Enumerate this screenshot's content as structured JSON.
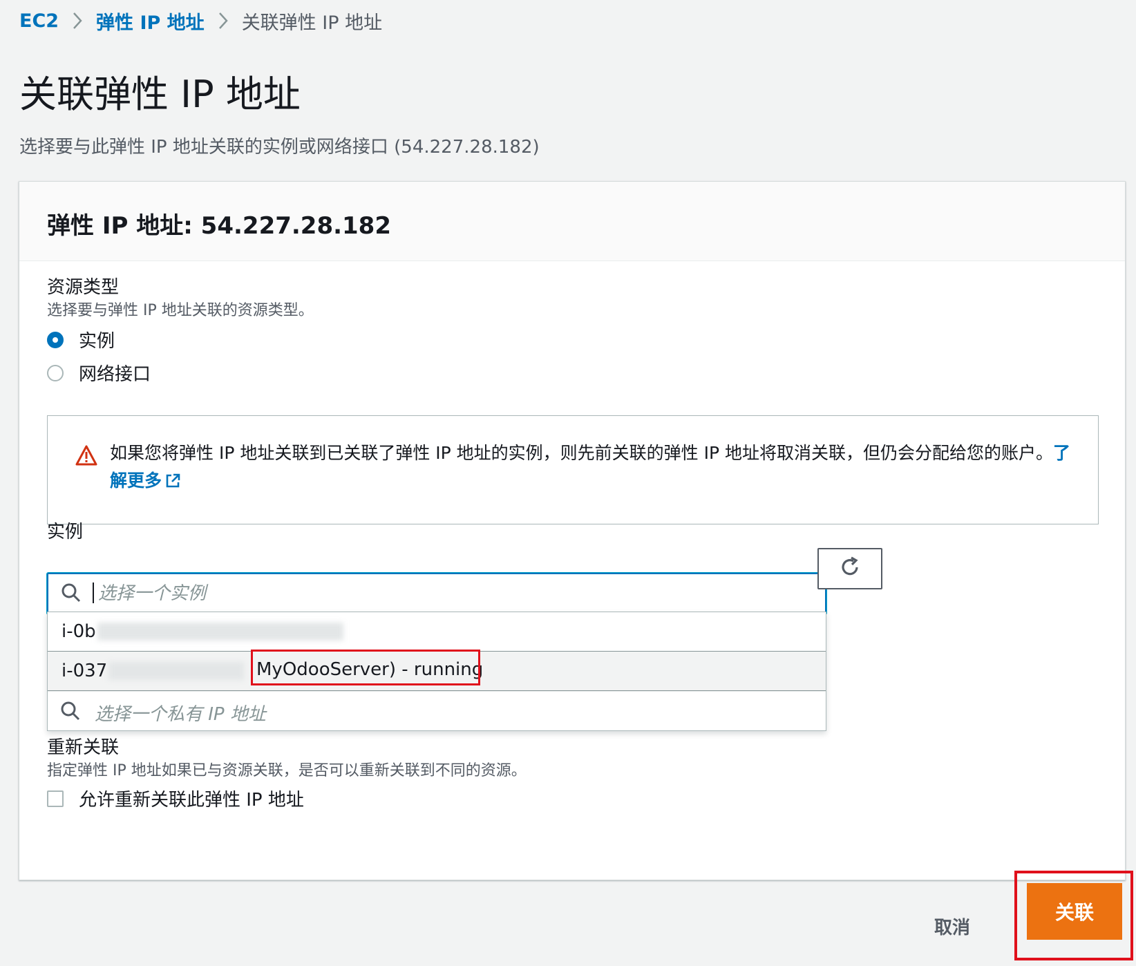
{
  "breadcrumb": {
    "root": "EC2",
    "parent": "弹性 IP 地址",
    "current": "关联弹性 IP 地址"
  },
  "page": {
    "title": "关联弹性 IP 地址",
    "description": "选择要与此弹性 IP 地址关联的实例或网络接口 (54.227.28.182)"
  },
  "panel": {
    "title": "弹性 IP 地址: 54.227.28.182"
  },
  "resource_type": {
    "label": "资源类型",
    "hint": "选择要与弹性 IP 地址关联的资源类型。",
    "options": [
      {
        "label": "实例",
        "selected": true
      },
      {
        "label": "网络接口",
        "selected": false
      }
    ]
  },
  "alert": {
    "text": "如果您将弹性 IP 地址关联到已关联了弹性 IP 地址的实例，则先前关联的弹性 IP 地址将取消关联，但仍会分配给您的账户。",
    "link": "了解更多"
  },
  "instance": {
    "label": "实例",
    "placeholder": "选择一个实例",
    "options": [
      {
        "prefix": "i-0b"
      },
      {
        "prefix": "i-037",
        "status": "MyOdooServer) - running"
      }
    ],
    "private_ip_placeholder": "选择一个私有 IP 地址"
  },
  "reassociation": {
    "label": "重新关联",
    "hint": "指定弹性 IP 地址如果已与资源关联，是否可以重新关联到不同的资源。",
    "checkbox_label": "允许重新关联此弹性 IP 地址",
    "checked": false
  },
  "actions": {
    "cancel": "取消",
    "associate": "关联"
  }
}
